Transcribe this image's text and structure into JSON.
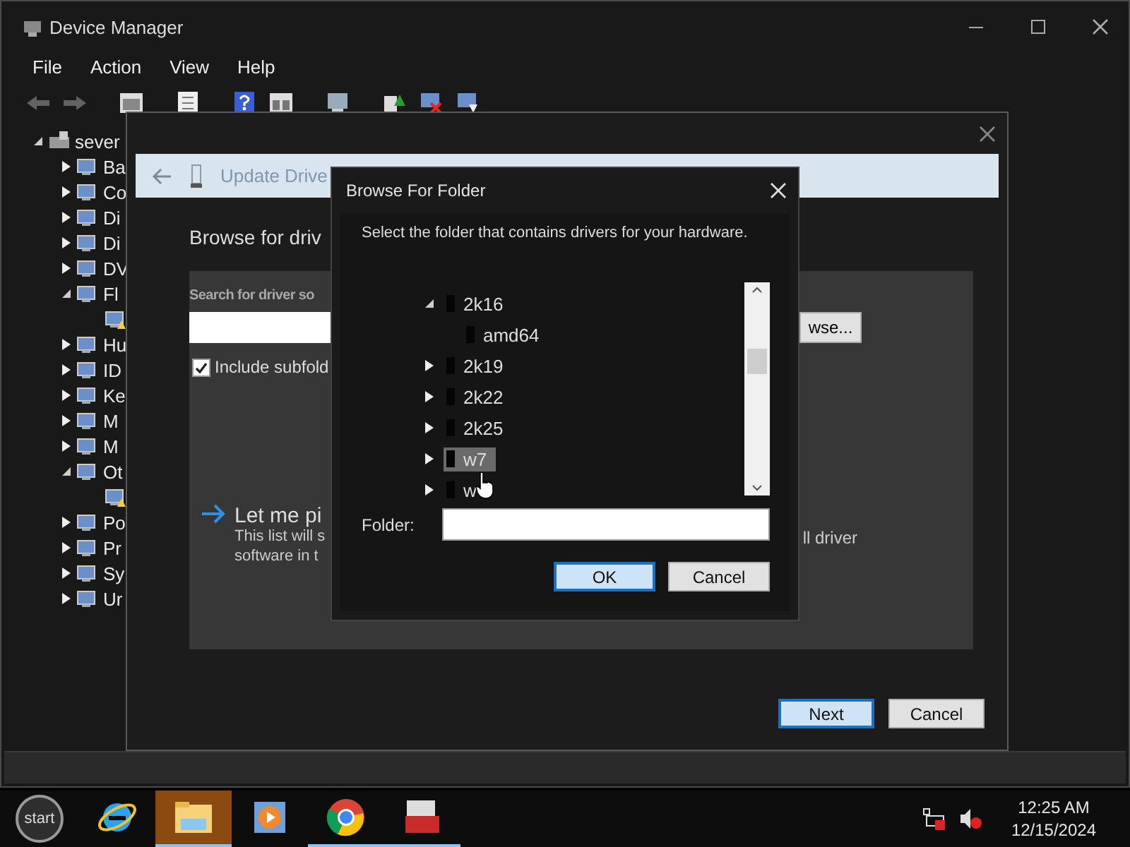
{
  "window": {
    "title": "Device Manager",
    "menu": [
      "File",
      "Action",
      "View",
      "Help"
    ],
    "toolbar": {
      "back_disabled": true,
      "forward_disabled": true
    }
  },
  "tree": {
    "label": "sever",
    "expanded": true,
    "children": [
      {
        "label": "Ba",
        "expanded": false
      },
      {
        "label": "Co",
        "expanded": false
      },
      {
        "label": "Di",
        "expanded": false
      },
      {
        "label": "Di",
        "expanded": false
      },
      {
        "label": "DV",
        "expanded": false
      },
      {
        "label": "Fl",
        "expanded": true,
        "children": [
          {
            "warning": true
          }
        ]
      },
      {
        "label": "Hu",
        "expanded": false
      },
      {
        "label": "ID",
        "expanded": false
      },
      {
        "label": "Ke",
        "expanded": false
      },
      {
        "label": "M",
        "expanded": false
      },
      {
        "label": "M",
        "expanded": false
      },
      {
        "label": "Ot",
        "expanded": true,
        "children": [
          {
            "warning": true
          }
        ]
      },
      {
        "label": "Po",
        "expanded": false
      },
      {
        "label": "Pr",
        "expanded": false
      },
      {
        "label": "Sy",
        "expanded": false
      },
      {
        "label": "Ur",
        "expanded": false
      }
    ]
  },
  "update_dialog": {
    "header": "Update Drive",
    "heading": "Browse for driv",
    "search_label": "Search for driver so",
    "browse_button": "wse...",
    "include_subfolders": {
      "label": "Include subfold",
      "checked": true
    },
    "option_title": "Let me pi",
    "option_lines": [
      "This list will s",
      "software in t"
    ],
    "option_right": "ll driver",
    "buttons": [
      {
        "label": "Next",
        "default": true
      },
      {
        "label": "Cancel",
        "default": false
      }
    ]
  },
  "browse_dialog": {
    "title": "Browse For Folder",
    "instruction": "Select the folder that contains drivers for your hardware.",
    "folders": [
      {
        "label": "2k16",
        "expanded": true,
        "selected": false,
        "children": [
          {
            "label": "amd64",
            "selected": false
          }
        ]
      },
      {
        "label": "2k19",
        "expanded": false,
        "selected": false
      },
      {
        "label": "2k22",
        "expanded": false,
        "selected": false
      },
      {
        "label": "2k25",
        "expanded": false,
        "selected": false
      },
      {
        "label": "w7",
        "expanded": false,
        "selected": true
      },
      {
        "label": "w",
        "expanded": false,
        "selected": false
      }
    ],
    "folder_label": "Folder:",
    "buttons": [
      {
        "label": "OK",
        "default": true
      },
      {
        "label": "Cancel",
        "default": false
      }
    ]
  },
  "taskbar": {
    "start": "start",
    "apps": [
      {
        "kind": "ie",
        "running": false,
        "highlighted": false
      },
      {
        "kind": "explorer",
        "running": true,
        "highlighted": true
      },
      {
        "kind": "media",
        "running": false,
        "highlighted": false
      },
      {
        "kind": "chrome",
        "running": true,
        "highlighted": false
      },
      {
        "kind": "toolbox",
        "running": true,
        "highlighted": false
      }
    ],
    "tray": {
      "network_error": true,
      "muted": true,
      "time": "12:25 AM",
      "date": "12/15/2024"
    }
  }
}
